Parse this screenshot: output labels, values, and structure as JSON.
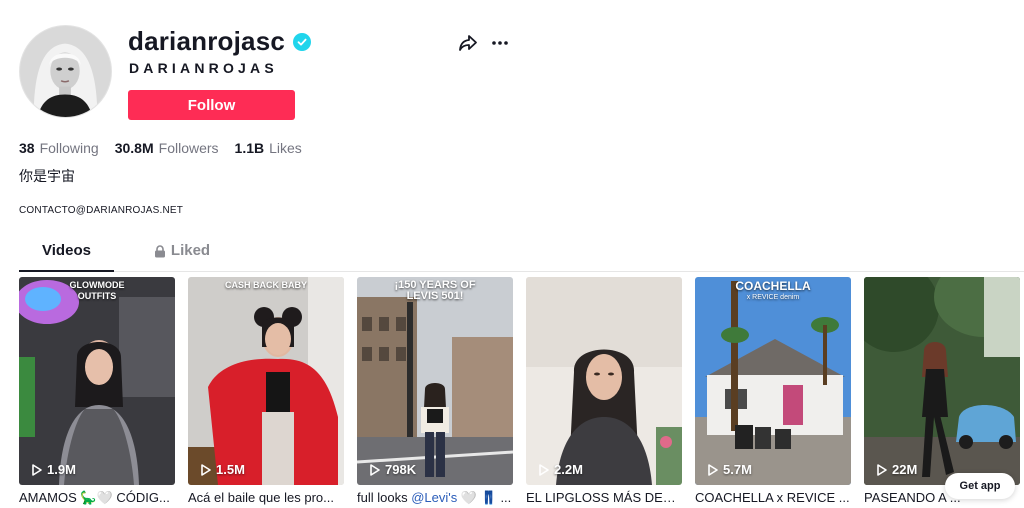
{
  "profile": {
    "username": "darianrojasc",
    "nickname": "DARIANROJAS",
    "follow_label": "Follow",
    "bio": "你是宇宙",
    "contact": "CONTACTO@DARIANROJAS.NET",
    "verified": true
  },
  "stats": [
    {
      "value": "38",
      "label": "Following"
    },
    {
      "value": "30.8M",
      "label": "Followers"
    },
    {
      "value": "1.1B",
      "label": "Likes"
    }
  ],
  "tabs": {
    "videos": "Videos",
    "liked": "Liked"
  },
  "videos": [
    {
      "views": "1.9M",
      "overlay": "GLOWMODE\nOUTFITS",
      "caption": "AMAMOS 🦕🤍 CÓDIG..."
    },
    {
      "views": "1.5M",
      "overlay": "CASH BACK BABY",
      "caption": "Acá el baile que les pro..."
    },
    {
      "views": "798K",
      "overlay": "¡150 YEARS OF\nLEVIS 501!",
      "caption_prefix": "full looks ",
      "caption_mention": "@Levi's",
      "caption_suffix": " 🤍 👖 ..."
    },
    {
      "views": "2.2M",
      "overlay": "",
      "caption": "EL LIPGLOSS MÁS DELI ..."
    },
    {
      "views": "5.7M",
      "overlay": "COACHELLA",
      "overlay_sub": "x REVICE denim",
      "caption": "COACHELLA x REVICE ..."
    },
    {
      "views": "22M",
      "overlay": "",
      "caption": "PASEANDO A ..."
    }
  ],
  "get_app_label": "Get app",
  "colors": {
    "follow": "#fe2c55",
    "verified": "#20d5ec",
    "text": "#161823",
    "muted": "#747580"
  }
}
